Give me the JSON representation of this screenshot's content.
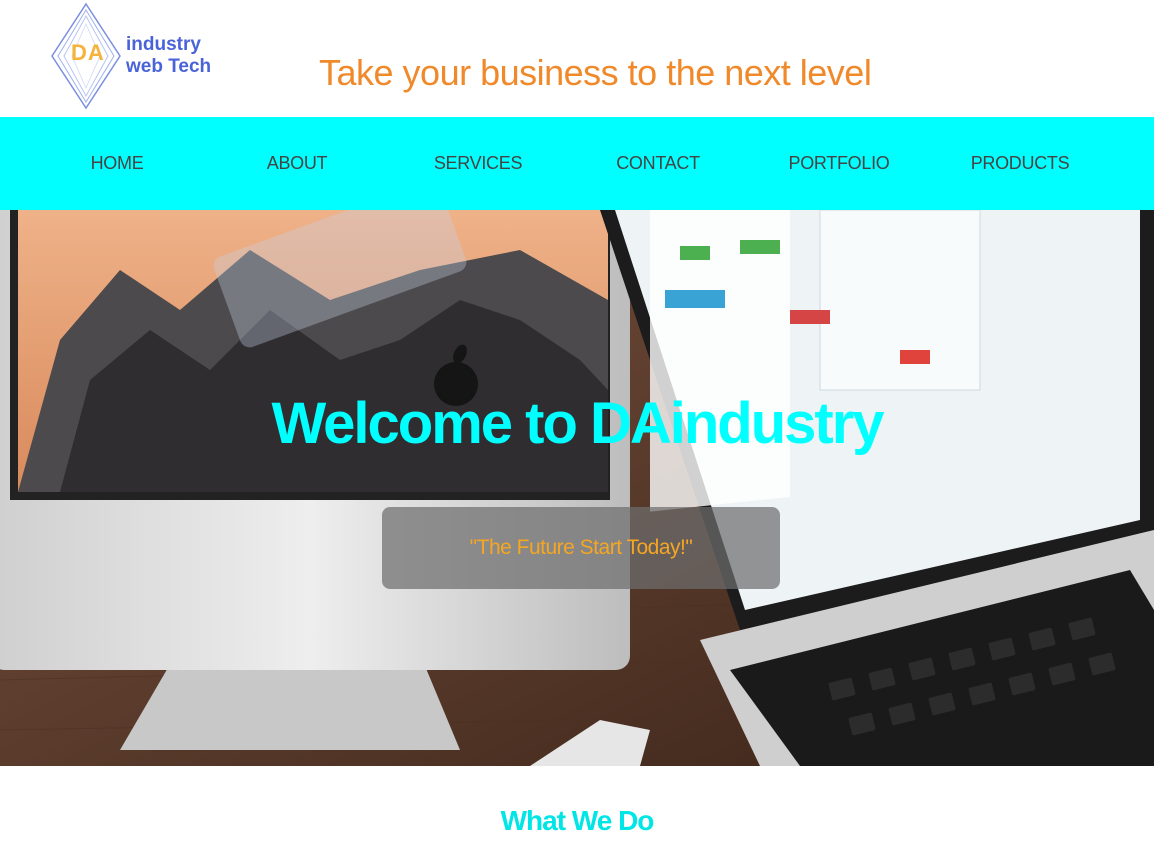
{
  "header": {
    "logo": {
      "initials": "DA",
      "line1": "industry",
      "line2": "web Tech"
    },
    "tagline": "Take your business to the next level"
  },
  "nav": {
    "items": [
      "HOME",
      "ABOUT",
      "SERVICES",
      "CONTACT",
      "PORTFOLIO",
      "PRODUCTS"
    ]
  },
  "hero": {
    "title": "Welcome to DAindustry",
    "subtitle": "\"The Future Start Today!\"",
    "image_desc_icons": [
      "imac",
      "macbook-pro"
    ]
  },
  "sections": {
    "what_we_do": "What We Do"
  },
  "colors": {
    "accent": "#00ffff",
    "tagline": "#f0892a",
    "logo_blue": "#4a63d8",
    "logo_orange": "#f6b33c",
    "subtitle": "#f5a623"
  }
}
